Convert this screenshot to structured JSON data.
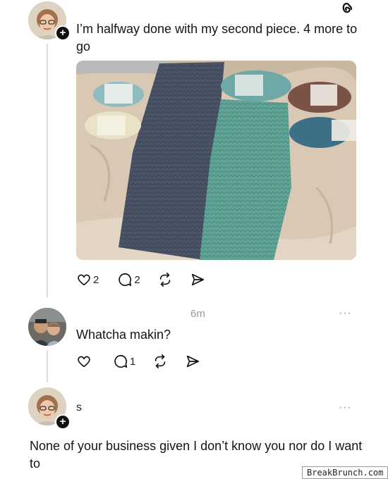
{
  "post": {
    "text": "I’m halfway done with my second piece. 4 more to go",
    "like_count": "2",
    "reply_count": "2"
  },
  "reply1": {
    "time": "6m",
    "text": "Whatcha makin?",
    "reply_count": "1",
    "more": "···"
  },
  "reply2": {
    "username": "s",
    "text": "None of your business given I don’t know you nor do I want to",
    "more": "···"
  },
  "header": {
    "more": "···"
  },
  "avatar_plus": "+",
  "watermark": "BreakBrunch.com",
  "icons": {
    "threads": "threads-logo-icon",
    "like": "heart-icon",
    "reply": "comment-icon",
    "repost": "repost-icon",
    "share": "send-icon"
  },
  "colors": {
    "yarn_navy": "#4a5363",
    "yarn_teal": "#5ea095",
    "yarn_brown": "#7a5246",
    "yarn_cream": "#e9e2c6",
    "yarn_light_teal": "#8fbcbf",
    "bed": "#d8c8b3"
  }
}
